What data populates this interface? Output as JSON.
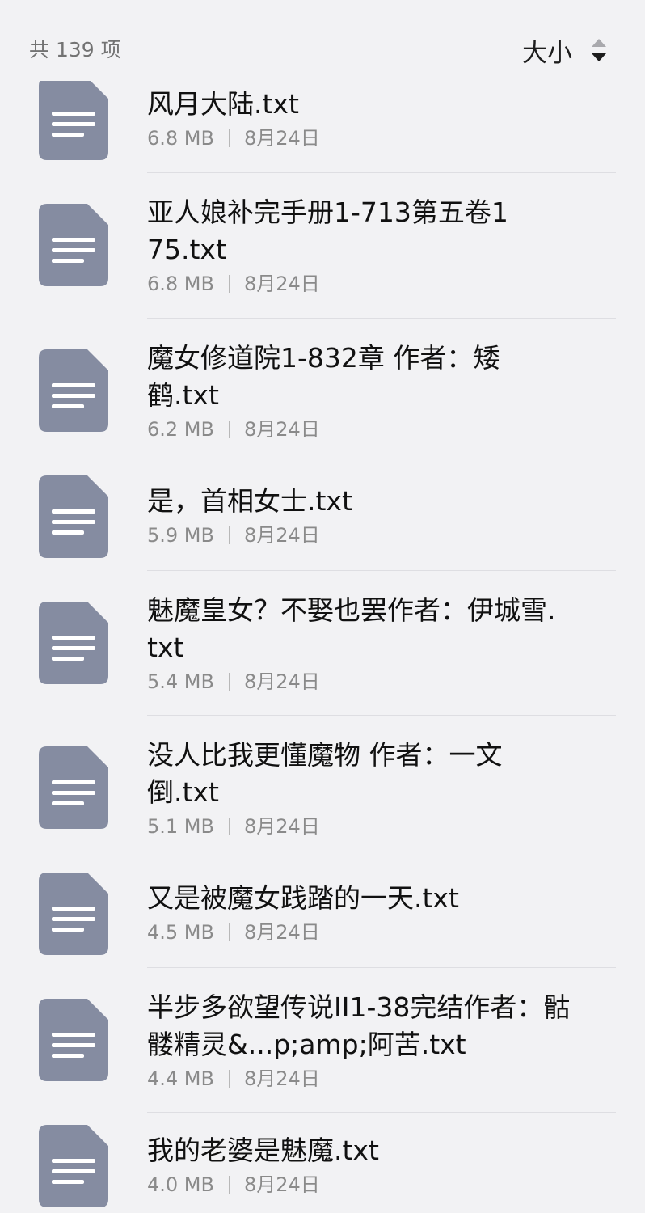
{
  "header": {
    "count_text": "共 139 项",
    "sort_label": "大小",
    "sort_icon": "sort-up-down-icon"
  },
  "files": [
    {
      "name": "风月大陆.txt",
      "size": "6.8 MB",
      "date": "8月24日"
    },
    {
      "name": "亚人娘补完手册1-713第五卷175.txt",
      "size": "6.8 MB",
      "date": "8月24日"
    },
    {
      "name": "魔女修道院1-832章 作者：矮鹤.txt",
      "size": "6.2 MB",
      "date": "8月24日"
    },
    {
      "name": "是，首相女士.txt",
      "size": "5.9 MB",
      "date": "8月24日"
    },
    {
      "name": "魅魔皇女？不娶也罢作者：伊城雪.txt",
      "size": "5.4 MB",
      "date": "8月24日"
    },
    {
      "name": "没人比我更懂魔物 作者：一文倒.txt",
      "size": "5.1 MB",
      "date": "8月24日"
    },
    {
      "name": "又是被魔女践踏的一天.txt",
      "size": "4.5 MB",
      "date": "8月24日"
    },
    {
      "name": "半步多欲望传说II1-38完结作者：骷髅精灵&...p;amp;阿苦.txt",
      "size": "4.4 MB",
      "date": "8月24日"
    },
    {
      "name": "我的老婆是魅魔.txt",
      "size": "4.0 MB",
      "date": "8月24日"
    }
  ],
  "colors": {
    "background": "#f2f2f4",
    "file_icon": "#858ca1",
    "divider": "#dedee2"
  }
}
